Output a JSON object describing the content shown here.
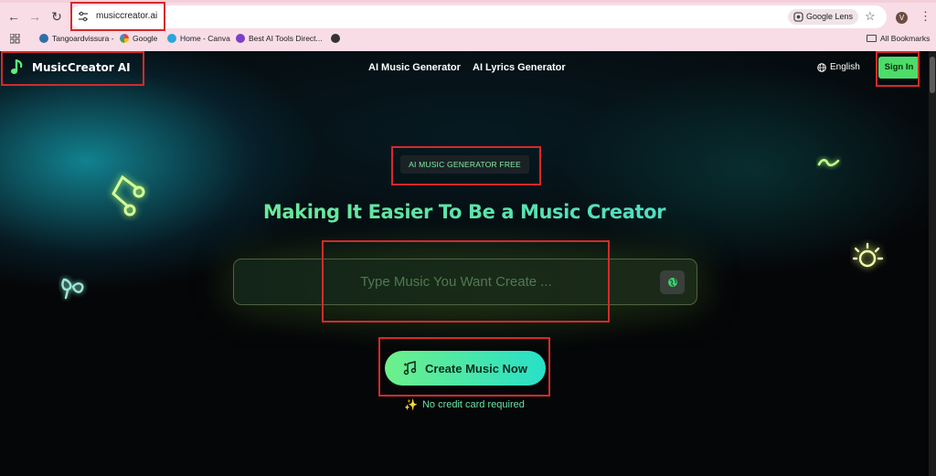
{
  "browser": {
    "address_bar": {
      "url": "musiccreator.ai"
    },
    "lens_label": "Google Lens",
    "profile_initial": "V",
    "bookmarks": [
      {
        "label": "Tangoardvissura -",
        "icon": "wordpress-icon"
      },
      {
        "label": "Google",
        "icon": "google-icon"
      },
      {
        "label": "Home - Canva",
        "icon": "canva-icon"
      },
      {
        "label": "Best AI Tools Direct...",
        "icon": "ai-tools-icon"
      },
      {
        "label": "",
        "icon": "globe-icon"
      }
    ],
    "all_bookmarks_label": "All Bookmarks"
  },
  "site": {
    "brand": "MusicCreator AI",
    "nav": [
      "AI Music Generator",
      "AI Lyrics Generator"
    ],
    "language": "English",
    "sign_in": "Sign In",
    "badge": "AI MUSIC GENERATOR FREE",
    "headline": "Making It Easier To Be a Music Creator",
    "prompt_placeholder": "Type Music You Want Create ...",
    "cta": "Create Music Now",
    "no_card": "No credit card required"
  },
  "colors": {
    "accent_green": "#4ddc68",
    "gradient_start": "#6df08a",
    "gradient_end": "#27e0c8",
    "annotation_red": "#d42a2a"
  }
}
